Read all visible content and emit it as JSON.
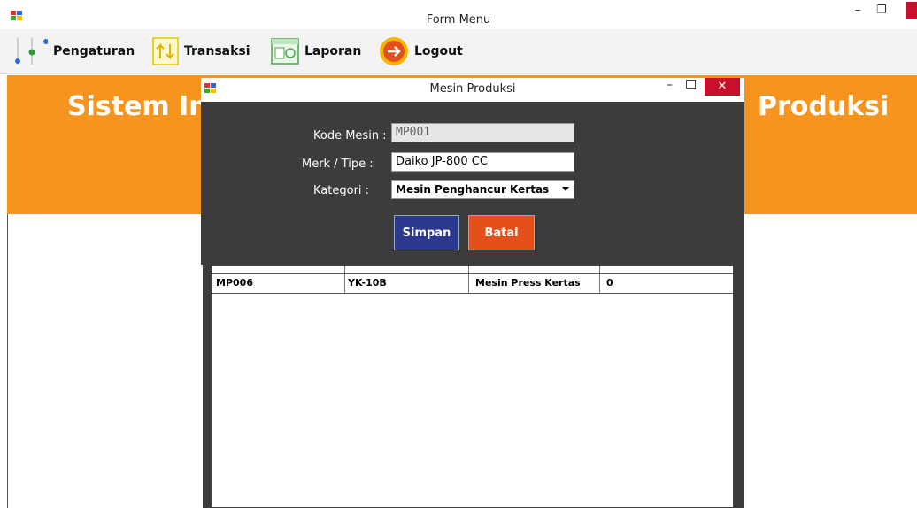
{
  "window": {
    "title": "Form Menu"
  },
  "menu": {
    "items": [
      {
        "label": "Pengaturan"
      },
      {
        "label": "Transaksi"
      },
      {
        "label": "Laporan"
      },
      {
        "label": "Logout"
      }
    ]
  },
  "banner": {
    "left_text": "Sistem In",
    "right_text": "Produksi"
  },
  "dialog": {
    "title": "Mesin Produksi",
    "fields": {
      "kode_label": "Kode Mesin :",
      "kode_value": "MP001",
      "merk_label": "Merk / Tipe :",
      "merk_value": "Daiko JP-800 CC",
      "kategori_label": "Kategori :",
      "kategori_value": "Mesin Penghancur Kertas"
    },
    "buttons": {
      "save": "Simpan",
      "cancel": "Batal"
    }
  },
  "grid": {
    "rows": [
      {
        "kode": "MP006",
        "merk": "YK-10B",
        "kategori": "Mesin Press Kertas",
        "jumlah": "0"
      }
    ]
  },
  "colors": {
    "banner": "#f7941d",
    "dialog_bg": "#3c3c3c",
    "save": "#2b3990",
    "cancel": "#e4501b",
    "close": "#c8102e"
  }
}
